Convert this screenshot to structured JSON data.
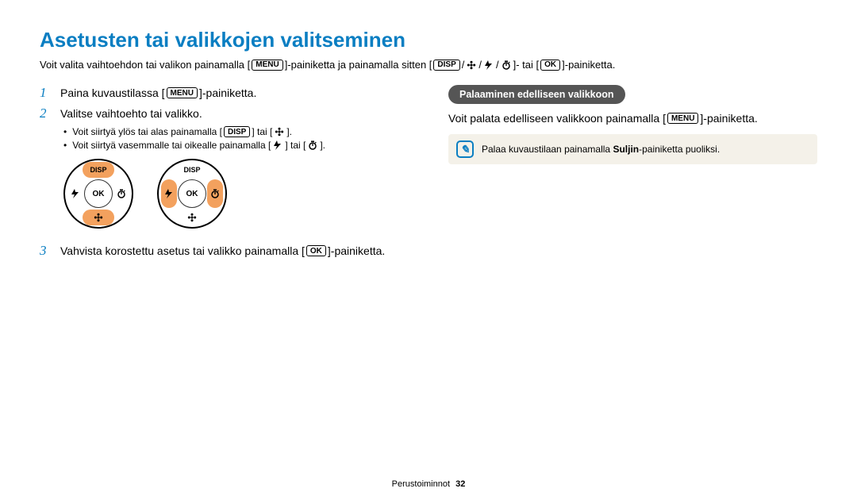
{
  "title": "Asetusten tai valikkojen valitseminen",
  "intro": {
    "p1": "Voit valita vaihtoehdon tai valikon painamalla [",
    "p2": "]-painiketta ja painamalla sitten [",
    "p3": "]- tai [",
    "p4": "]-painiketta."
  },
  "labels": {
    "menu": "MENU",
    "disp": "DISP",
    "ok": "OK"
  },
  "steps": {
    "s1": {
      "num": "1",
      "a": "Paina kuvaustilassa [",
      "b": "]-painiketta."
    },
    "s2": {
      "num": "2",
      "text": "Valitse vaihtoehto tai valikko."
    },
    "s2_b1": {
      "a": "Voit siirtyä ylös tai alas painamalla [",
      "b": "] tai [",
      "c": "]."
    },
    "s2_b2": {
      "a": "Voit siirtyä vasemmalle tai oikealle painamalla [",
      "b": "] tai [",
      "c": "]."
    },
    "s3": {
      "num": "3",
      "a": "Vahvista korostettu asetus tai valikko painamalla [",
      "b": "]-painiketta."
    }
  },
  "right": {
    "pill": "Palaaminen edelliseen valikkoon",
    "line": {
      "a": "Voit palata edelliseen valikkoon painamalla [",
      "b": "]-painiketta."
    },
    "note": {
      "a": "Palaa kuvaustilaan painamalla ",
      "bold": "Suljin",
      "b": "-painiketta puoliksi."
    }
  },
  "footer": {
    "section": "Perustoiminnot",
    "page": "32"
  }
}
